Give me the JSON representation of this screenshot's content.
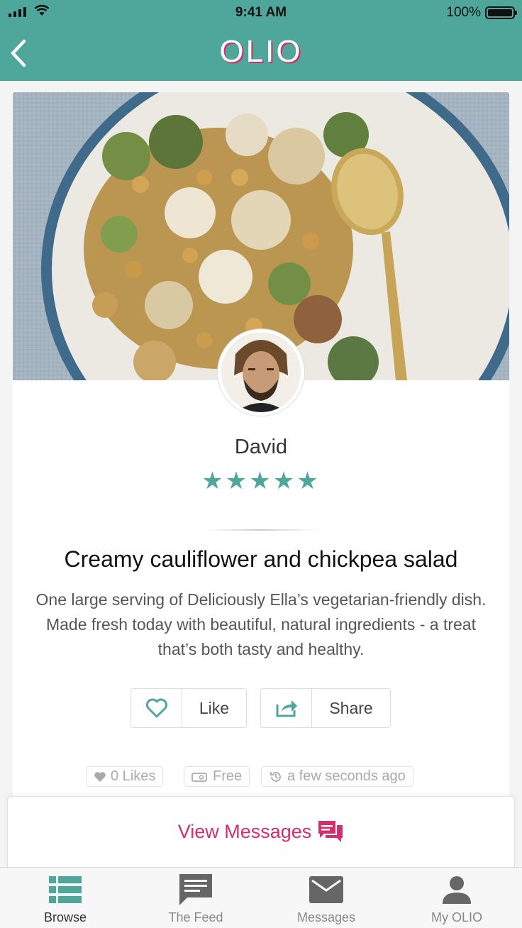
{
  "status_bar": {
    "time": "9:41 AM",
    "battery_percent": "100%"
  },
  "header": {
    "logo": "OLIO",
    "back_icon": "chevron-left-icon"
  },
  "listing": {
    "user_name": "David",
    "rating": 5,
    "stars": "★★★★★",
    "title": "Creamy cauliflower and chickpea salad",
    "description": "One large serving of Deliciously Ella’s vegetarian-friendly dish. Made fresh today with beautiful, natural ingredients - a treat that’s both tasty and healthy.",
    "like_label": "Like",
    "share_label": "Share",
    "likes_count": "0 Likes",
    "price": "Free",
    "posted_time": "a few seconds ago"
  },
  "messages": {
    "label": "View Messages"
  },
  "tabs": [
    {
      "label": "Browse",
      "icon": "list-icon",
      "active": true
    },
    {
      "label": "The Feed",
      "icon": "chat-bubble-icon",
      "active": false
    },
    {
      "label": "Messages",
      "icon": "envelope-icon",
      "active": false
    },
    {
      "label": "My OLIO",
      "icon": "person-icon",
      "active": false
    }
  ],
  "colors": {
    "brand_teal": "#4fa69b",
    "accent_pink": "#d62e6c"
  }
}
